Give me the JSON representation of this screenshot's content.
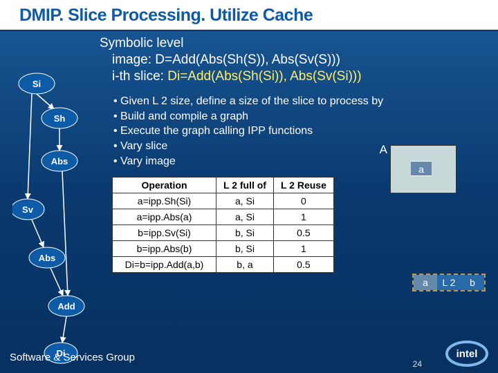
{
  "title": "DMIP. Slice Processing. Utilize Cache",
  "symbolic": {
    "heading": "Symbolic level",
    "image_line": "image: D=Add(Abs(Sh(S)), Abs(Sv(S)))",
    "slice_prefix": "i-th slice: ",
    "slice_expr": "Di=Add(Abs(Sh(Si)), Abs(Sv(Si)))"
  },
  "bullets": [
    "Given L 2 size, define a size of the slice to process by",
    "Build and compile a graph",
    "Execute the graph calling IPP functions",
    "Vary slice",
    "Vary image"
  ],
  "flow": {
    "n0": "Si",
    "n1": "Sh",
    "n2": "Abs",
    "n3": "Sv",
    "n4": "Abs",
    "n5": "Add",
    "n6": "Di"
  },
  "table": {
    "headers": [
      "Operation",
      "L 2 full of",
      "L 2 Reuse"
    ],
    "rows": [
      [
        "a=ipp.Sh(Si)",
        "a, Si",
        "0"
      ],
      [
        "a=ipp.Abs(a)",
        "a, Si",
        "1"
      ],
      [
        "b=ipp.Sv(Si)",
        "b, Si",
        "0.5"
      ],
      [
        "b=ipp.Abs(b)",
        "b, Si",
        "1"
      ],
      [
        "Di=b=ipp.Add(a,b)",
        "b, a",
        "0.5"
      ]
    ]
  },
  "right": {
    "A": "A",
    "a": "a",
    "strip": [
      "a",
      "L 2",
      "b"
    ]
  },
  "footer": {
    "group": "Software & Services Group",
    "page": "24",
    "logo_text": "intel"
  }
}
